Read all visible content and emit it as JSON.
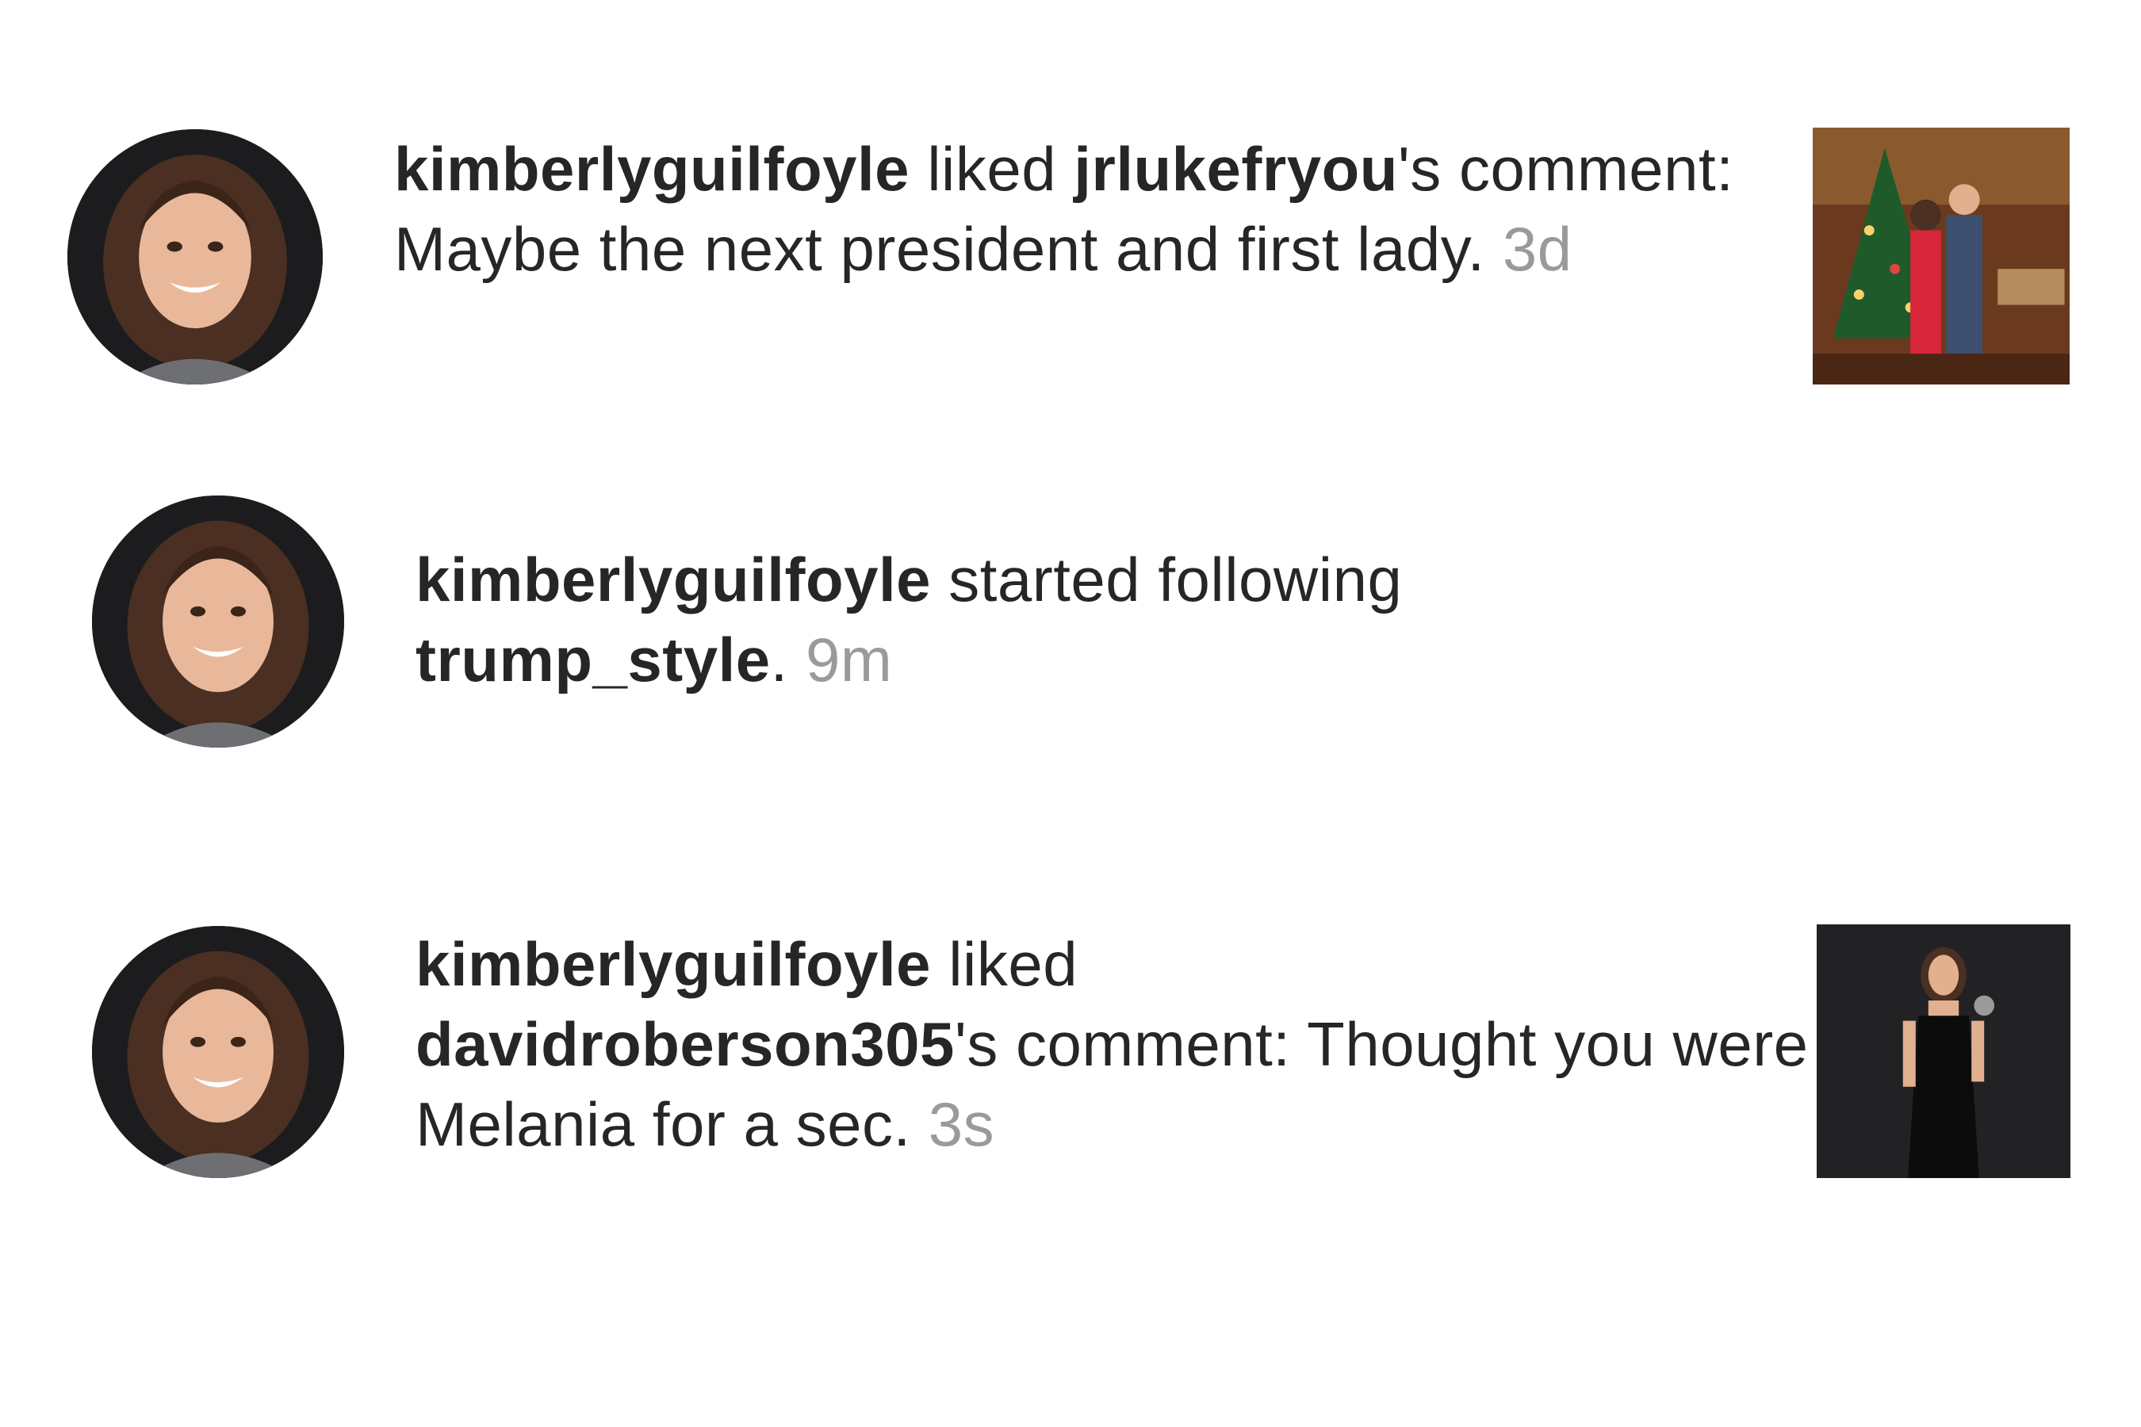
{
  "notifications": [
    {
      "avatar_icon": "profile-photo",
      "username": "kimberlyguilfoyle",
      "action": " liked ",
      "target_user": "jrlukefryou",
      "suffix": "'s comment: Maybe the next president and first lady.",
      "time": "3d",
      "thumbnail_icon": "post-photo-christmas-tree"
    },
    {
      "avatar_icon": "profile-photo",
      "username": "kimberlyguilfoyle",
      "action": " started following ",
      "target_user": "trump_style",
      "suffix": ".",
      "time": "9m"
    },
    {
      "avatar_icon": "profile-photo",
      "username": "kimberlyguilfoyle",
      "action": " liked ",
      "target_user": "davidroberson305",
      "suffix": "'s comment: Thought you were Melania for a sec.",
      "time": "3s",
      "thumbnail_icon": "post-photo-black-dress"
    }
  ],
  "colors": {
    "text": "#262626",
    "timestamp": "#9a9a9a",
    "background": "#ffffff"
  }
}
